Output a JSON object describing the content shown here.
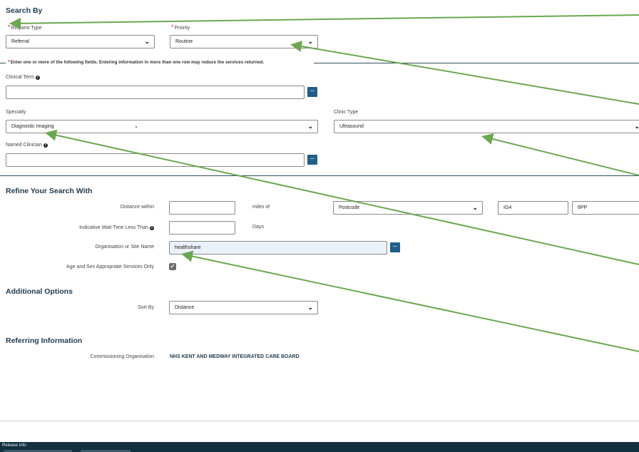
{
  "search_by": {
    "heading": "Search By",
    "request_type": {
      "label": "Request Type",
      "value": "Referral"
    },
    "priority": {
      "label": "Priority",
      "value": "Routine"
    },
    "instruction": "Enter one or more of the following fields. Entering information in more than one row may reduce the services returned.",
    "clinical_term": {
      "label": "Clinical Term",
      "value": "",
      "lookup": "..."
    },
    "specialty": {
      "label": "Specialty",
      "value": "Diagnostic Imaging"
    },
    "clinic_type": {
      "label": "Clinic Type",
      "value": "Ultrasound"
    },
    "named_clinician": {
      "label": "Named Clinician",
      "value": "",
      "lookup": "..."
    }
  },
  "refine": {
    "heading": "Refine Your Search With",
    "distance_within": {
      "label": "Distance within",
      "value": "",
      "miles_of": "miles of"
    },
    "postcode_type": {
      "value": "Postcode"
    },
    "postcode_part1": "IG4",
    "postcode_part2": "6PP",
    "wait_time": {
      "label": "Indicative Wait Time Less Than",
      "value": "",
      "unit": "Days"
    },
    "org_site": {
      "label": "Organisation or Site Name",
      "value": "healthshare",
      "lookup": "..."
    },
    "age_sex": {
      "label": "Age and Sex Appropriate Services Only",
      "checked": true,
      "check_glyph": "✓"
    }
  },
  "additional": {
    "heading": "Additional Options",
    "sort_by": {
      "label": "Sort By",
      "value": "Distance"
    }
  },
  "referring": {
    "heading": "Referring Information",
    "commissioning_label": "Commissioning Organisation",
    "commissioning_value": "NHS KENT AND MEDWAY INTEGRATED CARE BOARD"
  },
  "footer": {
    "label": "Release Info"
  },
  "glyphs": {
    "chevron": "⌄",
    "required": "*",
    "info": "i",
    "collapse": "—"
  },
  "colors": {
    "accent": "#1f5f8b",
    "heading": "#1f3a4d",
    "annotation_arrow": "#6aa84f",
    "footer": "#12303f",
    "required": "#c0392b"
  }
}
